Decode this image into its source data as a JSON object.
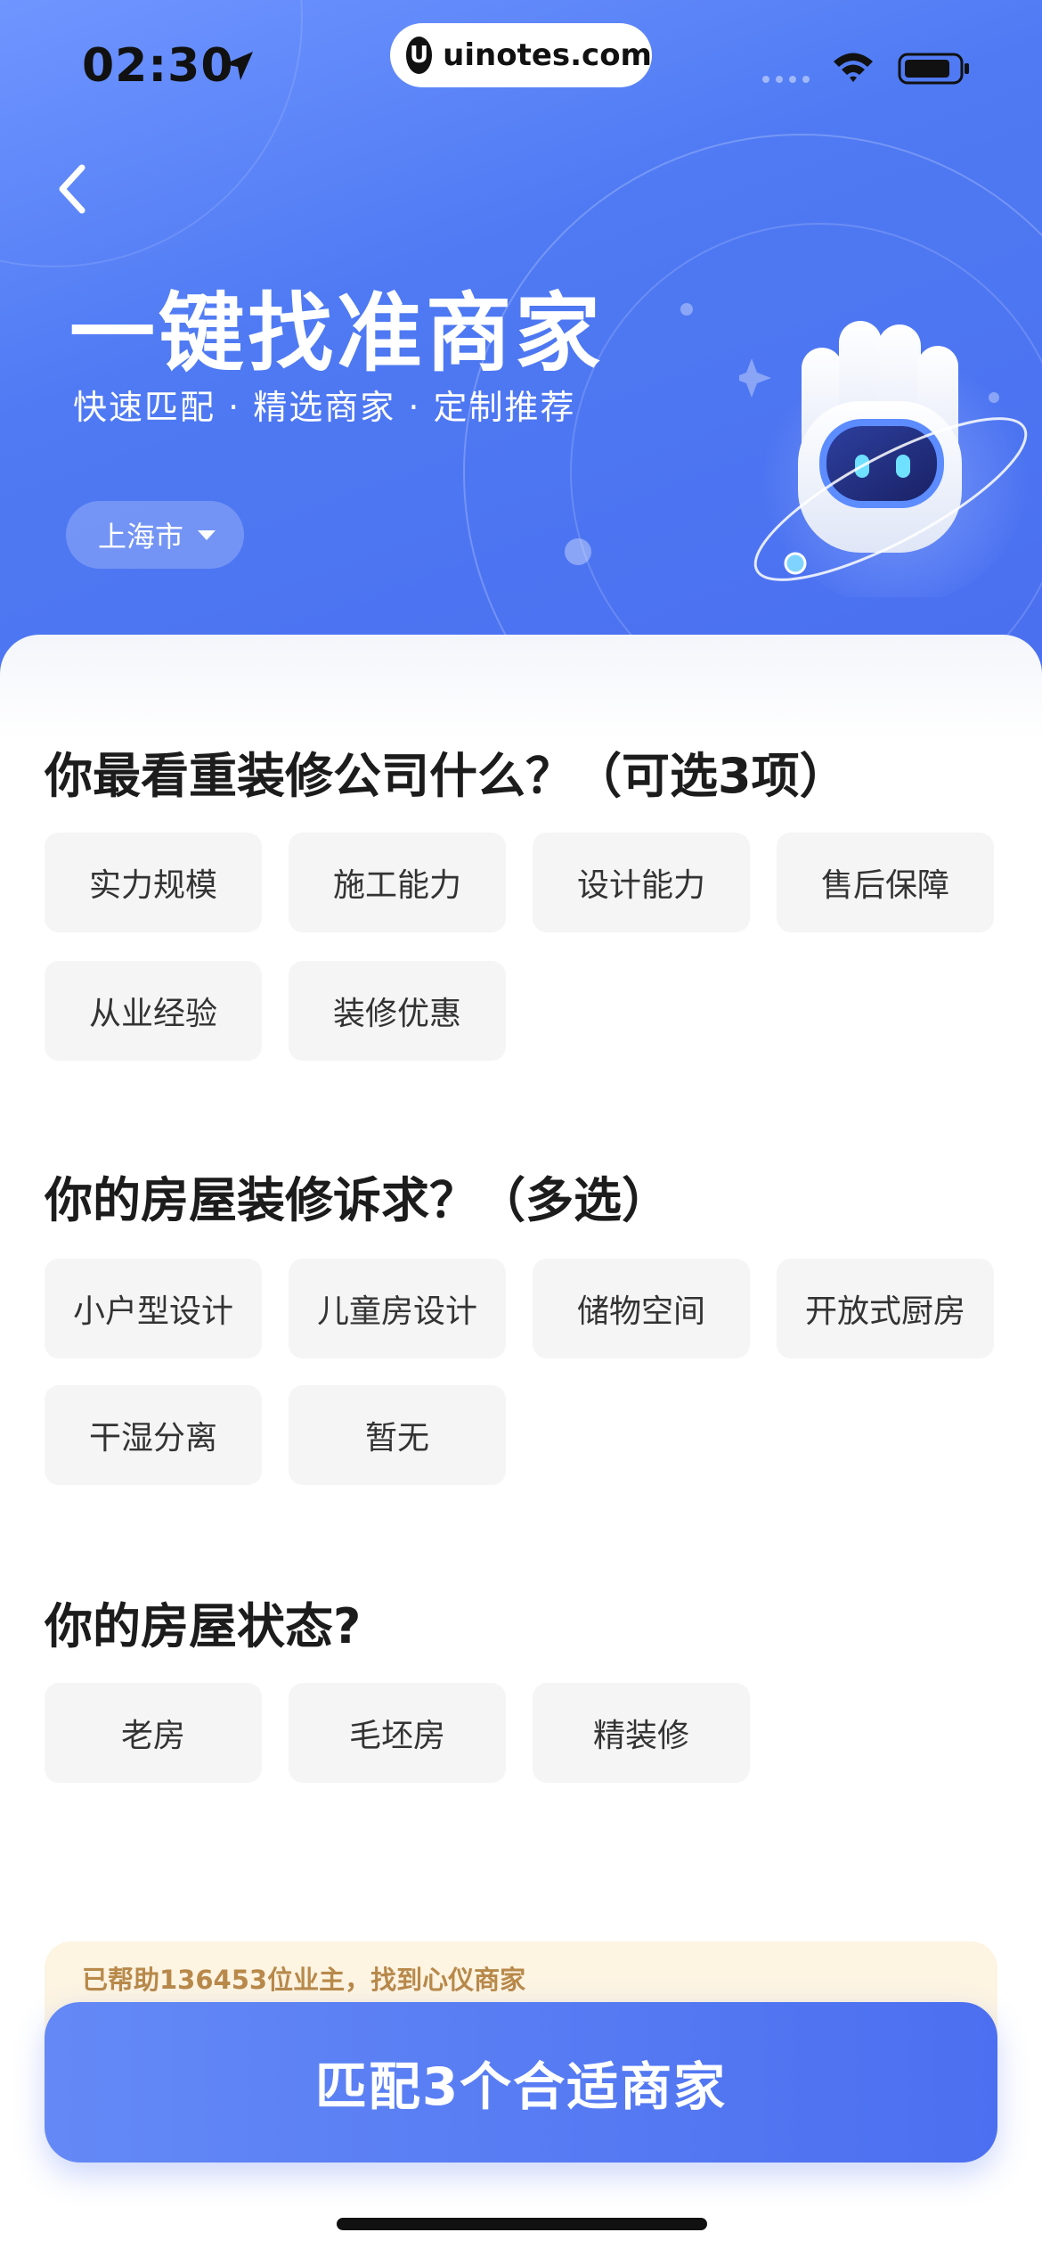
{
  "status_bar": {
    "time": "02:30",
    "url": "uinotes.com",
    "url_logo": "U"
  },
  "hero": {
    "title": "一键找准商家",
    "subtitle": "快速匹配 · 精选商家 · 定制推荐",
    "city": "上海市"
  },
  "sections": [
    {
      "title": "你最看重装修公司什么？（可选3项）",
      "options": [
        "实力规模",
        "施工能力",
        "设计能力",
        "售后保障",
        "从业经验",
        "装修优惠"
      ]
    },
    {
      "title": "你的房屋装修诉求？（多选）",
      "options": [
        "小户型设计",
        "儿童房设计",
        "储物空间",
        "开放式厨房",
        "干湿分离",
        "暂无"
      ]
    },
    {
      "title": "你的房屋状态?",
      "options": [
        "老房",
        "毛坯房",
        "精装修"
      ]
    }
  ],
  "footer": {
    "helper_text": "已帮助136453位业主，找到心仪商家",
    "cta_label": "匹配3个合适商家"
  },
  "colors": {
    "primary": "#4f7af3",
    "helper_bg": "#fdf4e2",
    "helper_text": "#b8894a",
    "option_bg": "#f5f5f5"
  },
  "icons": [
    "location-arrow-icon",
    "signal-icon",
    "wifi-icon",
    "battery-icon",
    "back-chevron-icon",
    "caret-down-icon",
    "robot-mascot"
  ]
}
